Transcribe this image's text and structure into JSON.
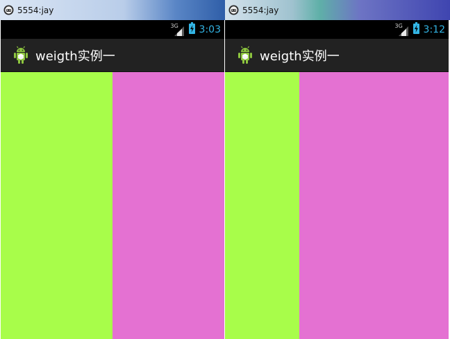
{
  "emulators": [
    {
      "window_title": "5554:jay",
      "status_clock": "3:03",
      "network_label": "3G",
      "app_title": "weigth实例一",
      "weights": [
        1,
        1
      ],
      "panes": [
        {
          "color": "#a8fd4a"
        },
        {
          "color": "#e471d2"
        }
      ]
    },
    {
      "window_title": "5554:jay",
      "status_clock": "3:12",
      "network_label": "3G",
      "app_title": "weigth实例一",
      "weights": [
        1,
        2
      ],
      "panes": [
        {
          "color": "#a8fd4a"
        },
        {
          "color": "#e471d2"
        }
      ]
    }
  ],
  "colors": {
    "accent_clock": "#33b5e5",
    "action_bar": "#222222",
    "status_bar": "#000000"
  },
  "icons": {
    "window": "android-emulator-icon",
    "signal": "signal-strength-icon",
    "battery": "battery-charging-icon",
    "app": "android-robot-icon"
  }
}
